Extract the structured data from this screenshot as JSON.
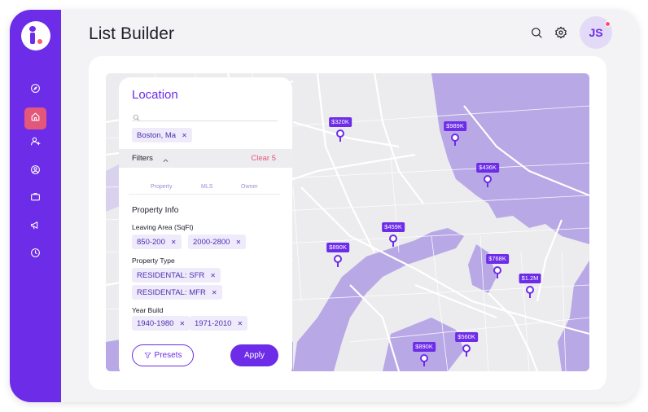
{
  "header": {
    "title": "List Builder",
    "avatar_initials": "JS"
  },
  "sidebar": {
    "items": [
      {
        "icon": "compass-icon",
        "active": false
      },
      {
        "icon": "home-icon",
        "active": true
      },
      {
        "icon": "add-user-icon",
        "active": false
      },
      {
        "icon": "user-circle-icon",
        "active": false
      },
      {
        "icon": "briefcase-icon",
        "active": false
      },
      {
        "icon": "megaphone-icon",
        "active": false
      },
      {
        "icon": "clock-icon",
        "active": false
      }
    ]
  },
  "panel": {
    "title": "Location",
    "search_value": "",
    "location_chip": "Boston, Ma",
    "filters_label": "Filters",
    "clear_label": "Clear 5",
    "tabs": [
      "Property",
      "MLS",
      "Owner"
    ],
    "section_title": "Property Info",
    "living_area_label": "Leaving Area (SqFt)",
    "living_area_chips": [
      "850-200",
      "2000-2800"
    ],
    "property_type_label": "Property Type",
    "property_type_chips": [
      "RESIDENTAL: SFR",
      "RESIDENTAL: MFR"
    ],
    "year_build_label": "Year Build",
    "year_build_chips": [
      "1940-1980",
      "1971-2010"
    ],
    "presets_label": "Presets",
    "apply_label": "Apply"
  },
  "map": {
    "pins": [
      "$320K",
      "$989K",
      "$436K",
      "$459K",
      "$890K",
      "$768K",
      "$1.2M",
      "$890K",
      "$560K"
    ]
  },
  "colors": {
    "accent": "#6c2ce8",
    "active_nav": "#e2577a",
    "water": "#b9a8e6",
    "land": "#ececee"
  }
}
